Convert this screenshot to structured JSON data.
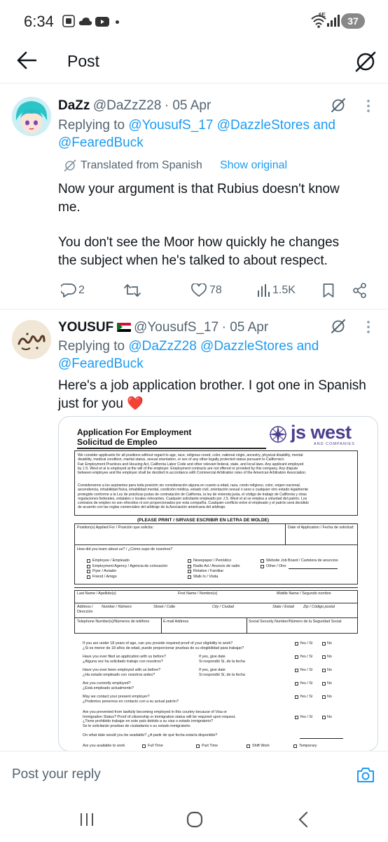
{
  "status_bar": {
    "time": "6:34",
    "battery": "37",
    "network": "6E"
  },
  "header": {
    "title": "Post"
  },
  "tweet1": {
    "name": "DaZz",
    "handle": "@DaZzZ28",
    "date": "· 05 Apr",
    "replying_prefix": "Replying to",
    "mention1": "@YousufS_17",
    "mention2": "@DazzleStores",
    "and": "and",
    "mention3": "@FearedBuck",
    "translated": "Translated from Spanish",
    "show_original": "Show original",
    "text_line1": "Now your argument is that Rubius doesn't know",
    "text_line2": "me.",
    "text_line3": "You don't see the Moor how quickly he changes",
    "text_line4": "the subject when he's talked to about respect.",
    "replies": "2",
    "reposts": "",
    "likes": "78",
    "views": "1.5K"
  },
  "tweet2": {
    "name": "YOUSUF",
    "flag": "🇸🇩",
    "handle": "@YousufS_17",
    "date": "· 05 Apr",
    "replying_prefix": "Replying to",
    "mention1": "@DaZzZ28",
    "mention2": "@DazzleStores",
    "and": "and",
    "mention3": "@FearedBuck",
    "text_line1": "Here's a job application brother. I got one in Spanish",
    "text_line2": "just for you",
    "heart": "❤️"
  },
  "document": {
    "title1": "Application For Employment",
    "title2": "Solicitud de Empleo",
    "logo_main": "js west",
    "logo_sub": "AND COMPANIES",
    "para_en": [
      "We consider applicants for all positions without regard to age, race, religious creed, color, national origin, ancestry, physical disability, mental",
      "disability, medical condition, marital status, sexual orientation, or sex of any other legally protected status pursuant to California's",
      "Fair Employment Practices and Housing Act, California Labor Code and other relevant federal, state, and local laws. Any applicant employed",
      "by J.S. West et al is employed at the will of the employer. Employment contracts are not offered or provided by this company. Any dispute",
      "between employee and the employer shall be decided in accordance with Commercial Arbitration rules of the American Arbitration Association."
    ],
    "para_es": [
      "Consideramos a los aspirantes para toda posición sin consideración alguna en cuanto a edad, raza, credo religioso, color, origen nacional,",
      "ascendencia, inhabilidad física, inhabilidad mental, condición médica, estado civil, orientación sexual o sexo o cualquier otro estado legalmente",
      "protegido conforme a la Ley de prácticas justas de contratación de California, la ley de vivienda justa, el código de trabajo de California y otras",
      "regulaciones federales, estatales o locales relevantes. Cualquier solicitante empleado por J.S. West et al se emplea a voluntad del patrón. Los",
      "contratos de empleo no son ofrecidos ni son proporcionados por esta compañía. Cualquier conflicto entre el empleado y el patrón será decidido",
      "de acuerdo con las reglas comerciales del arbitraje de la Asociación americana del arbitraje."
    ],
    "print_banner": "(PLEASE PRINT / SIRVASE ESCRIBIR EN LETRA DE MOLDE)",
    "position_label": "Position(s) Applied For / Posición que solicita:",
    "date_label": "Date of Application / Fecha de solicitud:",
    "heard_label": "How did you learn about us? / ¿Cómo supo de nosotros?",
    "heard_col1": [
      "Employee / Empleado",
      "Employment Agency / Agencia de colocación",
      "Flyer / Aviador",
      "Friend / Amigo"
    ],
    "heard_col2": [
      "Newspaper / Periódico",
      "Radio Ad / Anuncio de radio",
      "Relative / Familiar",
      "Walk In / Visita"
    ],
    "heard_col3": [
      "Website Job Board / Cartelera de anuncios",
      "Other / Otro"
    ],
    "last_name": "Last Name / Apellido(s)",
    "first_name": "First Name / Nombre(s)",
    "middle_name": "Middle Name / Segundo nombre",
    "address": "Address / Dirección",
    "number": "Number / Número",
    "street": "Street / Calle",
    "city": "City / Ciudad",
    "state": "State / Estad",
    "zip": "Zip / Código postal",
    "phone": "Telephone Number(s)/Números de teléfono",
    "email": "E-mail Address",
    "ssn": "Social Security Number/Número de la Seguridad Social",
    "questions": [
      {
        "en": "If you are under 18 years of age, can you provide required proof of your eligibility to work?",
        "es": "¿Si es menor de 18 años de edad, puede proporcionar pruebas de su elegibilidad para trabajar?"
      },
      {
        "en": "Have you ever filed an application with us before?",
        "es": "¿Alguna vez ha solicitado trabajo con nosotros?"
      },
      {
        "en": "Have you ever been employed with us before?",
        "es": "¿Ha estado empleado con nosotros antes?"
      },
      {
        "en": "Are you currently employed?",
        "es": "¿Está empleado actualmente?"
      },
      {
        "en": "May we contact your present employer?",
        "es": "¿Podemos ponernos en contacto con a su actual patrón?"
      }
    ],
    "if_yes": "If yes, give date",
    "si_resp": "Si respondió Sí, de la fecha",
    "yes_si": "Yes / Sí",
    "no": "No",
    "visa_q": [
      "Are you prevented from lawfully becoming employed in this country because of Visa or",
      "Immigration Status?  Proof of citizenship or immigration status will be required upon request.",
      "¿Tiene prohibido trabajar en este país debido a su visa o estado inmigratorio?",
      "Se le solicitarán pruebas de ciudadanía o su estado inmigratorio."
    ],
    "available_date": "On what date would you be available? ¿A partir de qué fecha estaría disponible?",
    "available_to_work": "Are you available to work",
    "full_time": "Full Time",
    "part_time": "Part Time",
    "shift_work": "Shift Work",
    "temporary": "Temporary"
  },
  "reply_bar": {
    "placeholder": "Post your reply"
  },
  "colors": {
    "accent": "#1d9bf0",
    "text": "#0f1419",
    "muted": "#536471",
    "logo": "#4b3f8f"
  }
}
